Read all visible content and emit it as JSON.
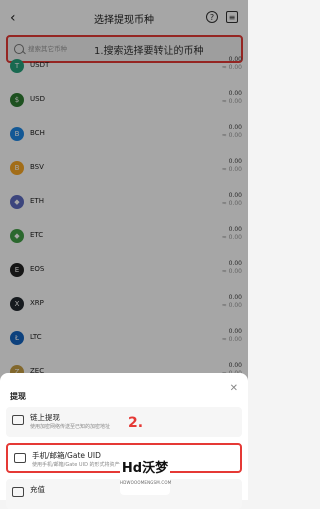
{
  "header": {
    "back_icon": "‹",
    "title": "选择提现币种",
    "help_icon": "?",
    "doc_icon": "≡"
  },
  "search": {
    "placeholder": "搜索其它币种",
    "annotation": "1.搜索选择要转让的币种"
  },
  "coins": [
    {
      "symbol": "USDT",
      "amount": "0.00",
      "sub": "≈ 0.00",
      "color": "#26a17b",
      "glyph": "T"
    },
    {
      "symbol": "USD",
      "amount": "0.00",
      "sub": "≈ 0.00",
      "color": "#2e7d32",
      "glyph": "$"
    },
    {
      "symbol": "BCH",
      "amount": "0.00",
      "sub": "≈ 0.00",
      "color": "#1e88e5",
      "glyph": "B"
    },
    {
      "symbol": "BSV",
      "amount": "0.00",
      "sub": "≈ 0.00",
      "color": "#f9a825",
      "glyph": "B"
    },
    {
      "symbol": "ETH",
      "amount": "0.00",
      "sub": "≈ 0.00",
      "color": "#5c6bc0",
      "glyph": "◆"
    },
    {
      "symbol": "ETC",
      "amount": "0.00",
      "sub": "≈ 0.00",
      "color": "#43a047",
      "glyph": "◆"
    },
    {
      "symbol": "EOS",
      "amount": "0.00",
      "sub": "≈ 0.00",
      "color": "#222222",
      "glyph": "E"
    },
    {
      "symbol": "XRP",
      "amount": "0.00",
      "sub": "≈ 0.00",
      "color": "#23292f",
      "glyph": "X"
    },
    {
      "symbol": "LTC",
      "amount": "0.00",
      "sub": "≈ 0.00",
      "color": "#1565c0",
      "glyph": "Ł"
    },
    {
      "symbol": "ZEC",
      "amount": "0.00",
      "sub": "≈ 0.00",
      "color": "#c8a045",
      "glyph": "Z"
    }
  ],
  "sheet": {
    "title": "提现",
    "close_icon": "✕",
    "options": [
      {
        "title": "链上提现",
        "desc": "使用加密网络传送至已知的加密地址"
      },
      {
        "title": "手机/邮箱/Gate UID",
        "desc": "使用手机/邮箱/Gate UID 的形式将资产传送给站内用户"
      },
      {
        "title": "充值",
        "desc": ""
      }
    ],
    "annotation": "2."
  },
  "watermark": {
    "title": "Hd沃梦",
    "sub": "HDWOOOMENGSM.COM"
  }
}
